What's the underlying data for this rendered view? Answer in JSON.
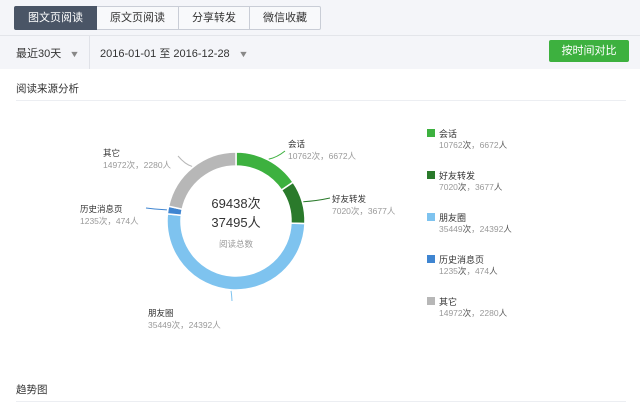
{
  "tabs": [
    {
      "label": "图文页阅读",
      "active": true
    },
    {
      "label": "原文页阅读",
      "active": false
    },
    {
      "label": "分享转发",
      "active": false
    },
    {
      "label": "微信收藏",
      "active": false
    }
  ],
  "filter": {
    "period": "最近30天",
    "range_start": "2016-01-01",
    "range_sep": "至",
    "range_end": "2016-12-28",
    "compare_button": "按时间对比"
  },
  "section1_title": "阅读来源分析",
  "section2_title": "趋势图",
  "center": {
    "times": "69438次",
    "people": "37495人",
    "caption": "阅读总数"
  },
  "colors": {
    "primary": "#3db13f",
    "tab_active": "#4a5566"
  },
  "chart_data": {
    "type": "pie",
    "donut": true,
    "categories": [
      "会话",
      "好友转发",
      "朋友圈",
      "历史消息页",
      "其它"
    ],
    "series": [
      {
        "values": [
          10762,
          7020,
          35449,
          1235,
          14972
        ]
      },
      {
        "values": [
          6672,
          3677,
          24392,
          474,
          2280
        ]
      }
    ],
    "stats": [
      {
        "label": "会话",
        "times": "10762",
        "people": "6672",
        "color": "#3db13f"
      },
      {
        "label": "好友转发",
        "times": "7020",
        "people": "3677",
        "color": "#2a7a2b"
      },
      {
        "label": "朋友圈",
        "times": "35449",
        "people": "24392",
        "color": "#7ec3ef"
      },
      {
        "label": "历史消息页",
        "times": "1235",
        "people": "474",
        "color": "#3f85d1"
      },
      {
        "label": "其它",
        "times": "14972",
        "people": "2280",
        "color": "#b7b7b7"
      }
    ],
    "unit_times": "次",
    "unit_people": "人",
    "legend_position": "right"
  }
}
